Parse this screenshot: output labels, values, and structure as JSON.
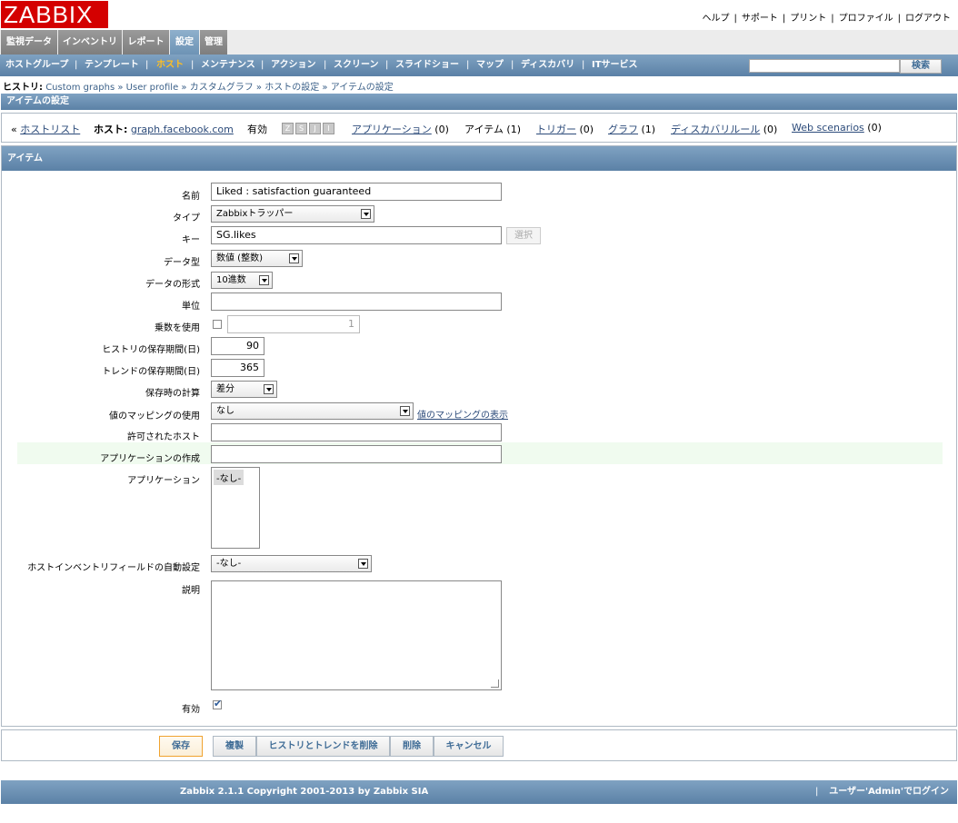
{
  "header": {
    "logo": "ZABBIX",
    "links": [
      "ヘルプ",
      "サポート",
      "プリント",
      "プロファイル",
      "ログアウト"
    ],
    "link_sep": "|"
  },
  "main_menu": [
    {
      "label": "監視データ",
      "active": false
    },
    {
      "label": "インベントリ",
      "active": false
    },
    {
      "label": "レポート",
      "active": false
    },
    {
      "label": "設定",
      "active": true
    },
    {
      "label": "管理",
      "active": false
    }
  ],
  "sub_menu": [
    {
      "label": "ホストグループ",
      "active": false
    },
    {
      "label": "テンプレート",
      "active": false
    },
    {
      "label": "ホスト",
      "active": true
    },
    {
      "label": "メンテナンス",
      "active": false
    },
    {
      "label": "アクション",
      "active": false
    },
    {
      "label": "スクリーン",
      "active": false
    },
    {
      "label": "スライドショー",
      "active": false
    },
    {
      "label": "マップ",
      "active": false
    },
    {
      "label": "ディスカバリ",
      "active": false
    },
    {
      "label": "ITサービス",
      "active": false
    }
  ],
  "sub_menu_sep": "|",
  "search": {
    "value": "",
    "button": "検索"
  },
  "breadcrumb": {
    "prefix": "ヒストリ:",
    "items": [
      "Custom graphs",
      "User profile",
      "カスタムグラフ",
      "ホストの設定",
      "アイテムの設定"
    ],
    "sep": "»"
  },
  "page_title": "アイテムの設定",
  "host_bar": {
    "back_prefix": "«",
    "host_list": "ホストリスト",
    "host_label": "ホスト:",
    "host_name": "graph.facebook.com",
    "status": "有効",
    "icons": [
      "Z",
      "S",
      "J",
      "I"
    ],
    "applications": "アプリケーション",
    "applications_count": "(0)",
    "items": "アイテム",
    "items_count": "(1)",
    "triggers": "トリガー",
    "triggers_count": "(0)",
    "graphs": "グラフ",
    "graphs_count": "(1)",
    "discovery": "ディスカバリルール",
    "discovery_count": "(0)",
    "web": "Web scenarios",
    "web_count": "(0)"
  },
  "form": {
    "title": "アイテム",
    "name_label": "名前",
    "name_value": "Liked : satisfaction guaranteed",
    "type_label": "タイプ",
    "type_value": "Zabbixトラッパー",
    "key_label": "キー",
    "key_value": "SG.likes",
    "key_select_button": "選択",
    "data_type_label": "データ型",
    "data_type_value": "数値 (整数)",
    "data_format_label": "データの形式",
    "data_format_value": "10進数",
    "units_label": "単位",
    "units_value": "",
    "multiplier_label": "乗数を使用",
    "multiplier_checked": false,
    "multiplier_value": "1",
    "history_label": "ヒストリの保存期間(日)",
    "history_value": "90",
    "trends_label": "トレンドの保存期間(日)",
    "trends_value": "365",
    "store_label": "保存時の計算",
    "store_value": "差分",
    "valuemap_label": "値のマッピングの使用",
    "valuemap_value": "なし",
    "valuemap_link": "値のマッピングの表示",
    "allowed_hosts_label": "許可されたホスト",
    "allowed_hosts_value": "",
    "new_app_label": "アプリケーションの作成",
    "new_app_value": "",
    "apps_label": "アプリケーション",
    "apps_options": [
      "-なし-"
    ],
    "inventory_label": "ホストインベントリフィールドの自動設定",
    "inventory_value": "-なし-",
    "description_label": "説明",
    "description_value": "",
    "enabled_label": "有効",
    "enabled_checked": true
  },
  "buttons": {
    "save": "保存",
    "clone": "複製",
    "clear_history": "ヒストリとトレンドを削除",
    "delete": "削除",
    "cancel": "キャンセル"
  },
  "footer": {
    "copyright": "Zabbix 2.1.1 Copyright 2001-2013 by Zabbix SIA",
    "sep": "|",
    "login": "ユーザー'Admin'でログイン"
  }
}
